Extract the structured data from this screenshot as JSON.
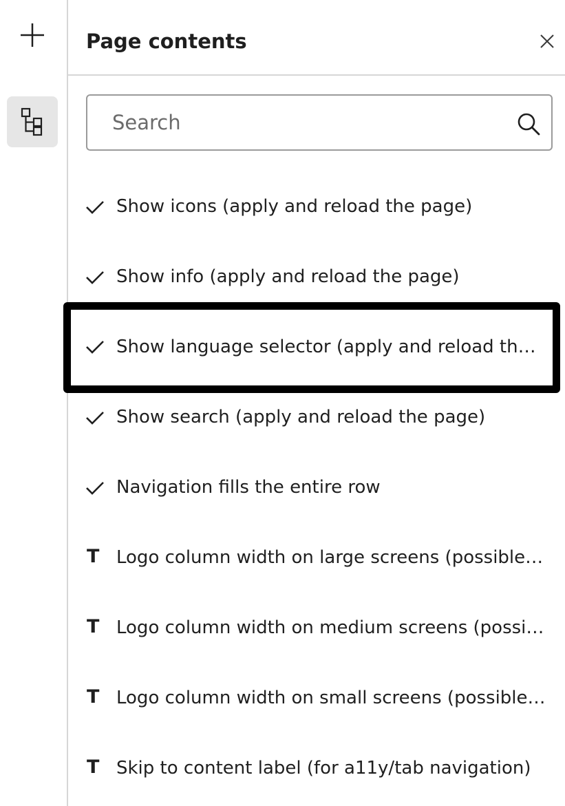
{
  "rail": {
    "add_icon": "plus-icon",
    "tree_icon": "tree-structure-icon"
  },
  "panel": {
    "title": "Page contents",
    "close_icon": "close-icon"
  },
  "search": {
    "value": "",
    "placeholder": "Search",
    "icon": "search-icon"
  },
  "items": [
    {
      "type": "checkbox",
      "icon": "check-icon",
      "label": "Show icons (apply and reload the page)"
    },
    {
      "type": "checkbox",
      "icon": "check-icon",
      "label": "Show info (apply and reload the page)"
    },
    {
      "type": "checkbox",
      "icon": "check-icon",
      "label": "Show language selector (apply and reload the page)"
    },
    {
      "type": "checkbox",
      "icon": "check-icon",
      "label": "Show search (apply and reload the page)"
    },
    {
      "type": "checkbox",
      "icon": "check-icon",
      "label": "Navigation fills the entire row"
    },
    {
      "type": "text",
      "icon": "text-icon",
      "glyph": "T",
      "label": "Logo column width on large screens (possible values)"
    },
    {
      "type": "text",
      "icon": "text-icon",
      "glyph": "T",
      "label": "Logo column width on medium screens (possible values)"
    },
    {
      "type": "text",
      "icon": "text-icon",
      "glyph": "T",
      "label": "Logo column width on small screens (possible values)"
    },
    {
      "type": "text",
      "icon": "text-icon",
      "glyph": "T",
      "label": "Skip to content label (for a11y/tab navigation)"
    }
  ],
  "colors": {
    "border": "#d6d6d6",
    "active_bg": "#e6e6e6",
    "highlight": "#000000",
    "text": "#1f1f1f"
  }
}
